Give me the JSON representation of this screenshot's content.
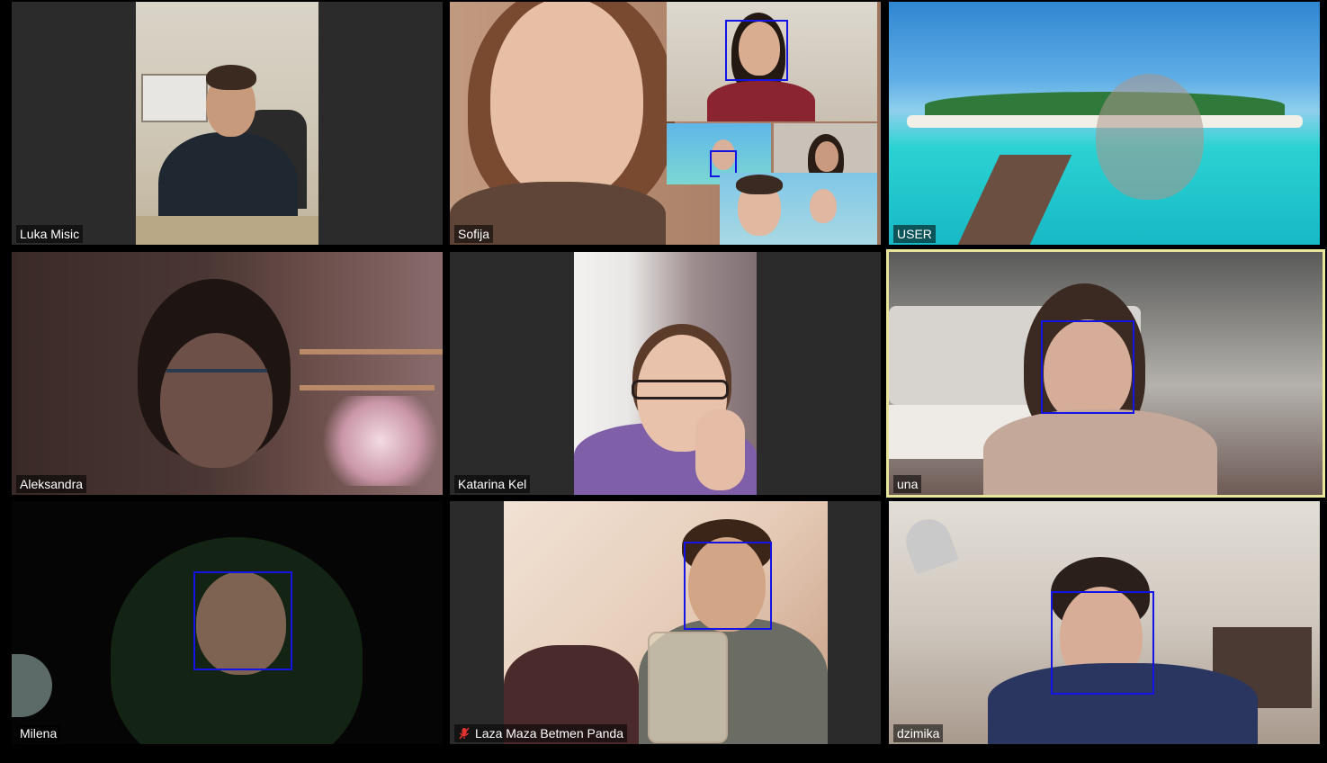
{
  "participants": [
    {
      "name": "Luka Misic",
      "muted": false,
      "active": false
    },
    {
      "name": "Sofija",
      "muted": false,
      "active": false
    },
    {
      "name": "USER",
      "muted": false,
      "active": false
    },
    {
      "name": "Aleksandra",
      "muted": false,
      "active": false
    },
    {
      "name": "Katarina Kel",
      "muted": false,
      "active": false
    },
    {
      "name": "una",
      "muted": false,
      "active": true
    },
    {
      "name": "Milena",
      "muted": false,
      "active": false
    },
    {
      "name": "Laza Maza Betmen Panda",
      "muted": true,
      "active": false
    },
    {
      "name": "dzimika",
      "muted": false,
      "active": false
    }
  ],
  "colors": {
    "tile_background": "#2b2b2b",
    "active_speaker_border": "#e9e59a",
    "face_detection_box": "#1414e6",
    "muted_icon": "#e0322f"
  },
  "icons": {
    "muted": "mic-off-icon"
  }
}
